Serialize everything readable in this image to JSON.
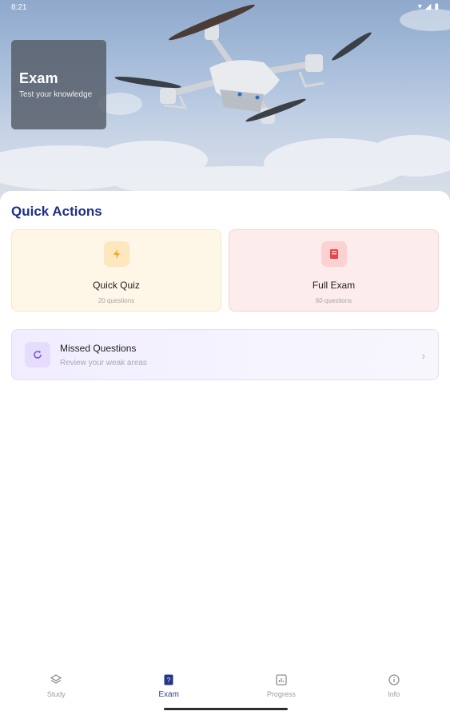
{
  "status_bar": {
    "time": "8:21"
  },
  "hero": {
    "title": "Exam",
    "subtitle": "Test your knowledge"
  },
  "quick_actions": {
    "title": "Quick Actions",
    "cards": [
      {
        "label": "Quick Quiz",
        "sub": "20 questions",
        "icon": "lightning-icon",
        "accent": "#f4a623"
      },
      {
        "label": "Full Exam",
        "sub": "60 questions",
        "icon": "book-icon",
        "accent": "#e34848"
      }
    ]
  },
  "missed": {
    "title": "Missed Questions",
    "sub": "Review your weak areas",
    "icon": "refresh-icon",
    "accent": "#7c5cd6"
  },
  "nav": {
    "items": [
      {
        "label": "Study",
        "icon": "layers-icon"
      },
      {
        "label": "Exam",
        "icon": "exam-icon",
        "active": true
      },
      {
        "label": "Progress",
        "icon": "chart-icon"
      },
      {
        "label": "Info",
        "icon": "info-icon"
      }
    ]
  }
}
